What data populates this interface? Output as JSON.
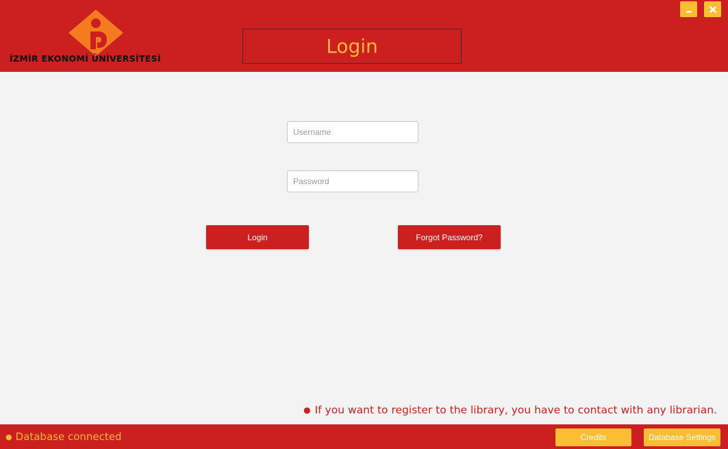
{
  "header": {
    "university_name": "İZMİR EKONOMİ ÜNİVERSİTESİ",
    "title": "Login"
  },
  "window_controls": {
    "minimize_icon": "minimize-icon",
    "close_icon": "close-icon"
  },
  "form": {
    "username_placeholder": "Username",
    "username_value": "",
    "password_placeholder": "Password",
    "password_value": "",
    "login_label": "Login",
    "forgot_label": "Forgot Password?"
  },
  "notice": {
    "text": "If you want to register to the library, you have to contact with any librarian."
  },
  "footer": {
    "status_text": "Database connected",
    "credits_label": "Credits",
    "db_settings_label": "Database Settings"
  },
  "colors": {
    "primary_red": "#cc1f1f",
    "accent_yellow": "#fbbd33",
    "title_text": "#f5b63a",
    "logo_orange": "#f47b20"
  }
}
